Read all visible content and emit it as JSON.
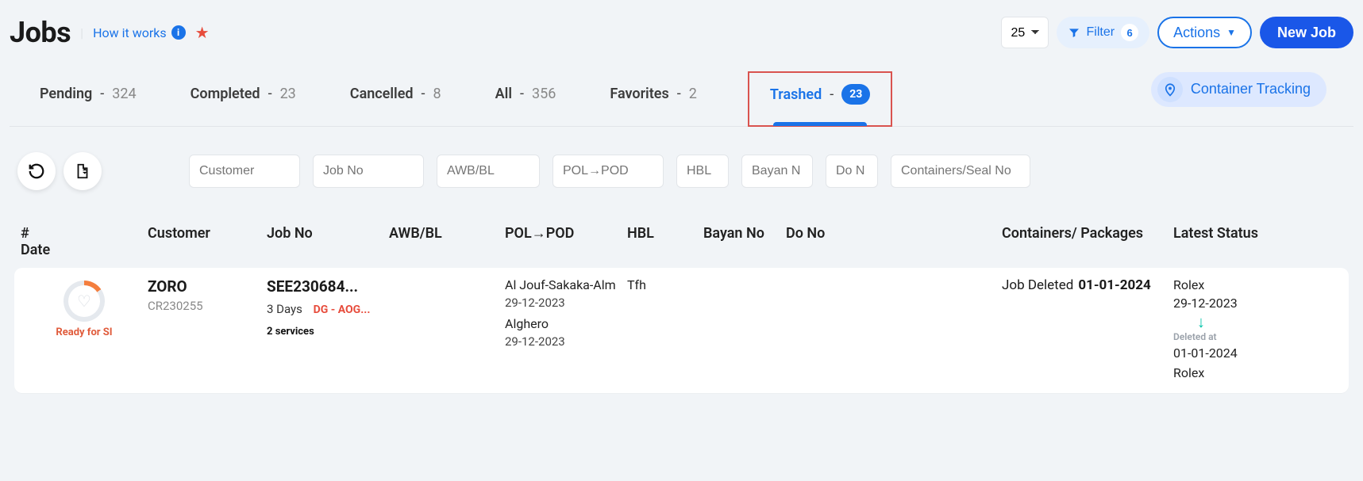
{
  "header": {
    "title": "Jobs",
    "how_it_works": "How it works",
    "page_size": "25",
    "filter_label": "Filter",
    "filter_count": "6",
    "actions_label": "Actions",
    "new_job_label": "New Job"
  },
  "tabs": {
    "pending": {
      "label": "Pending",
      "count": "324"
    },
    "completed": {
      "label": "Completed",
      "count": "23"
    },
    "cancelled": {
      "label": "Cancelled",
      "count": "8"
    },
    "all": {
      "label": "All",
      "count": "356"
    },
    "favorites": {
      "label": "Favorites",
      "count": "2"
    },
    "trashed": {
      "label": "Trashed",
      "count": "23"
    },
    "container_tracking": "Container Tracking"
  },
  "filters": {
    "customer_ph": "Customer",
    "jobno_ph": "Job No",
    "awb_ph": "AWB/BL",
    "pol_ph": "POL→POD",
    "hbl_ph": "HBL",
    "bayan_ph": "Bayan N",
    "dono_ph": "Do N",
    "cont_ph": "Containers/Seal No"
  },
  "columns": {
    "idx": "#",
    "customer": "Customer",
    "jobno": "Job No",
    "awb": "AWB/BL",
    "pol": "POL→POD",
    "hbl": "HBL",
    "bayan": "Bayan No",
    "dono": "Do No",
    "containers": "Containers/ Packages",
    "latest": "Latest Status",
    "date": "Date"
  },
  "row": {
    "status_text": "Ready for SI",
    "customer_name": "ZORO",
    "customer_code": "CR230255",
    "job_no": "SEE230684...",
    "days": "3 Days",
    "dg": "DG - AOG...",
    "services": "2 services",
    "pol_line1": "Al Jouf-Sakaka-Alm",
    "pol_date1": "29-12-2023",
    "pol_line2": "Alghero",
    "pol_date2": "29-12-2023",
    "hbl": "Tfh",
    "latest_prefix": "Job Deleted",
    "latest_date": "01-01-2024",
    "date_name1": "Rolex",
    "date_d1": "29-12-2023",
    "deleted_at_label": "Deleted at",
    "date_d2": "01-01-2024",
    "date_name2": "Rolex"
  }
}
